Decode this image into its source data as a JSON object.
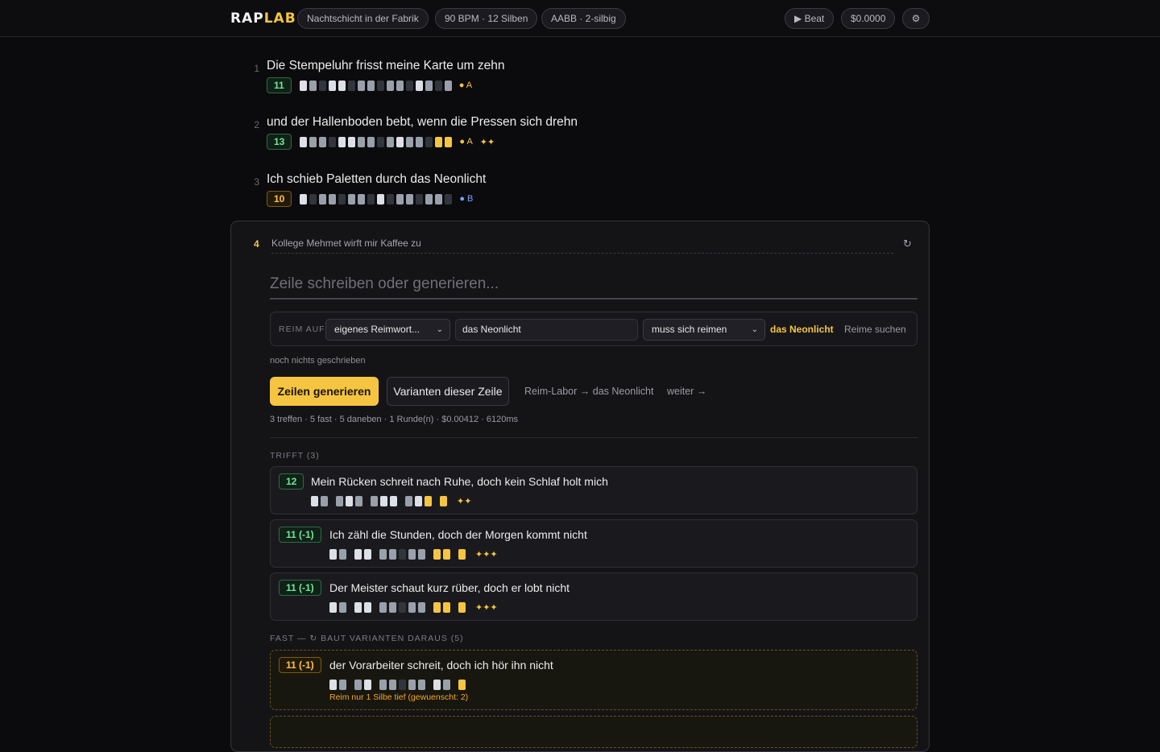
{
  "topbar": {
    "logo_a": "RAP",
    "logo_b": "LAB",
    "context": "Nachtschicht in der Fabrik",
    "tempo": "90 BPM · 12 Silben",
    "scheme": "AABB · 2-silbig",
    "beat": "▶ Beat",
    "cost": "$0.0000",
    "settings_icon": "⚙"
  },
  "lines": [
    {
      "n": "1",
      "text": "Die Stempeluhr frisst meine Karte um zehn",
      "syll": "11",
      "rhyme": "● A",
      "stars": ""
    },
    {
      "n": "2",
      "text": "und der Hallenboden bebt, wenn die Pressen sich drehn",
      "syll": "13",
      "rhyme": "● A",
      "stars": "✦✦"
    },
    {
      "n": "3",
      "text": "Ich schieb Paletten durch das Neonlicht",
      "syll": "10",
      "rhyme": "● B",
      "stars": ""
    }
  ],
  "editor": {
    "line_num": "4",
    "prompt": "Kollege Mehmet wirft mir Kaffee zu",
    "refresh_icon": "↻",
    "placeholder": "Zeile schreiben oder generieren...",
    "rhyme_label": "REIM AUF",
    "rhyme_mode": "eigenes Reimwort...",
    "rhyme_word": "das Neonlicht",
    "constraint": "muss sich reimen",
    "accent_word": "das Neonlicht",
    "find_rhymes": "Reime suchen",
    "note": "noch nichts geschrieben",
    "generate": "Zeilen generieren",
    "variants": "Varianten dieser Zeile",
    "lab_link": "Reim-Labor → das Neonlicht",
    "next_link": "weiter →",
    "stats": "3 treffen · 5 fast · 5 daneben · 1 Runde(n) · $0.00412 · 6120ms"
  },
  "sections": {
    "hits": "TRIFFT (3)",
    "near": "FAST — ↻ BAUT VARIANTEN DARAUS (5)"
  },
  "hits": [
    {
      "syll": "12",
      "text": "Mein Rücken schreit nach Ruhe, doch kein Schlaf holt mich",
      "stars": "✦✦"
    },
    {
      "syll": "11 (-1)",
      "text": "Ich zähl die Stunden, doch der Morgen kommt nicht",
      "stars": "✦✦✦"
    },
    {
      "syll": "11 (-1)",
      "text": "Der Meister schaut kurz rüber, doch er lobt nicht",
      "stars": "✦✦✦"
    }
  ],
  "near": [
    {
      "syll": "11 (-1)",
      "text": "der Vorarbeiter schreit, doch ich hör ihn nicht",
      "warn": "Reim nur 1 Silbe tief (gewuenscht: 2)"
    }
  ]
}
